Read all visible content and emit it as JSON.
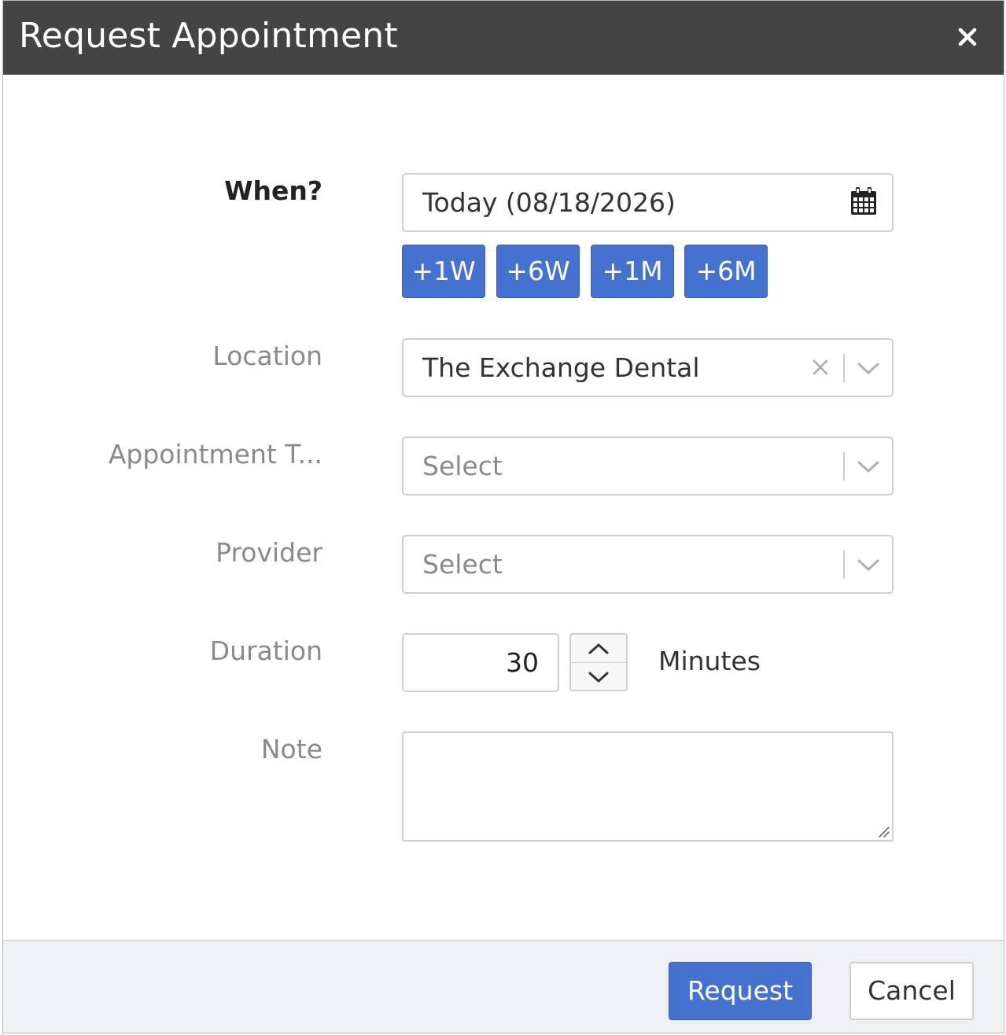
{
  "dialog": {
    "title": "Request Appointment",
    "close_icon": "close-icon"
  },
  "form": {
    "when": {
      "label": "When?",
      "value": "Today (08/18/2026)",
      "icon": "calendar-icon",
      "quick_buttons": [
        "+1W",
        "+6W",
        "+1M",
        "+6M"
      ]
    },
    "location": {
      "label": "Location",
      "value": "The Exchange Dental"
    },
    "appointment_type": {
      "label": "Appointment T...",
      "placeholder": "Select"
    },
    "provider": {
      "label": "Provider",
      "placeholder": "Select"
    },
    "duration": {
      "label": "Duration",
      "value": "30",
      "unit": "Minutes"
    },
    "note": {
      "label": "Note",
      "value": ""
    }
  },
  "footer": {
    "request_label": "Request",
    "cancel_label": "Cancel"
  },
  "colors": {
    "titlebar": "#444444",
    "primary": "#4571cf",
    "footer_bg": "#eef0f3"
  }
}
